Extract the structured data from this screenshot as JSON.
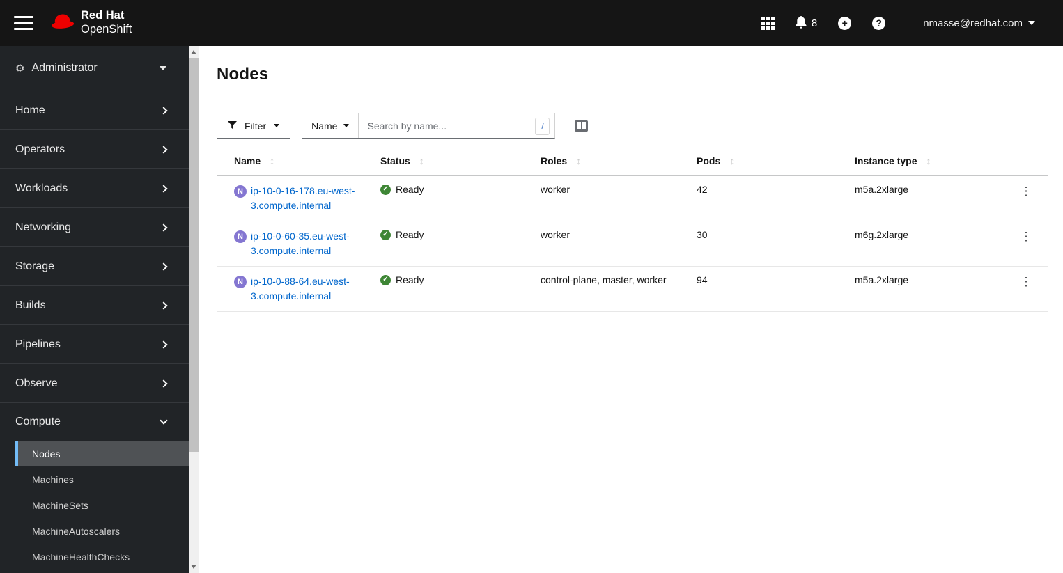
{
  "masthead": {
    "brand_line1": "Red Hat",
    "brand_line2": "OpenShift",
    "notifications_count": "8",
    "user": "nmasse@redhat.com"
  },
  "sidebar": {
    "perspective": {
      "label": "Administrator"
    },
    "items": [
      {
        "label": "Home"
      },
      {
        "label": "Operators"
      },
      {
        "label": "Workloads"
      },
      {
        "label": "Networking"
      },
      {
        "label": "Storage"
      },
      {
        "label": "Builds"
      },
      {
        "label": "Pipelines"
      },
      {
        "label": "Observe"
      }
    ],
    "compute_group": {
      "label": "Compute",
      "expanded": true,
      "subitems": [
        {
          "label": "Nodes",
          "active": true
        },
        {
          "label": "Machines"
        },
        {
          "label": "MachineSets"
        },
        {
          "label": "MachineAutoscalers"
        },
        {
          "label": "MachineHealthChecks"
        }
      ]
    }
  },
  "page": {
    "title": "Nodes"
  },
  "toolbar": {
    "filter_label": "Filter",
    "attribute_label": "Name",
    "search_placeholder": "Search by name...",
    "shortcut_key": "/"
  },
  "table": {
    "columns": [
      {
        "label": "Name"
      },
      {
        "label": "Status"
      },
      {
        "label": "Roles"
      },
      {
        "label": "Pods"
      },
      {
        "label": "Instance type"
      }
    ],
    "rows": [
      {
        "badge": "N",
        "name": "ip-10-0-16-178.eu-west-3.compute.internal",
        "status": "Ready",
        "roles": "worker",
        "pods": "42",
        "instance_type": "m5a.2xlarge"
      },
      {
        "badge": "N",
        "name": "ip-10-0-60-35.eu-west-3.compute.internal",
        "status": "Ready",
        "roles": "worker",
        "pods": "30",
        "instance_type": "m6g.2xlarge"
      },
      {
        "badge": "N",
        "name": "ip-10-0-88-64.eu-west-3.compute.internal",
        "status": "Ready",
        "roles": "control-plane, master, worker",
        "pods": "94",
        "instance_type": "m5a.2xlarge"
      }
    ]
  },
  "icons": {
    "sort": "↕",
    "kebab": "⋮",
    "check": "✓",
    "cogs": "⚙",
    "cogs_small": "⚙"
  },
  "colors": {
    "masthead_bg": "#151515",
    "sidebar_bg": "#212427",
    "sidebar_active_bg": "#4f5255",
    "accent": "#73bcf7",
    "link": "#0066cc",
    "success": "#3e8635",
    "node_badge": "#8476d1",
    "brand_red": "#ee0000"
  }
}
